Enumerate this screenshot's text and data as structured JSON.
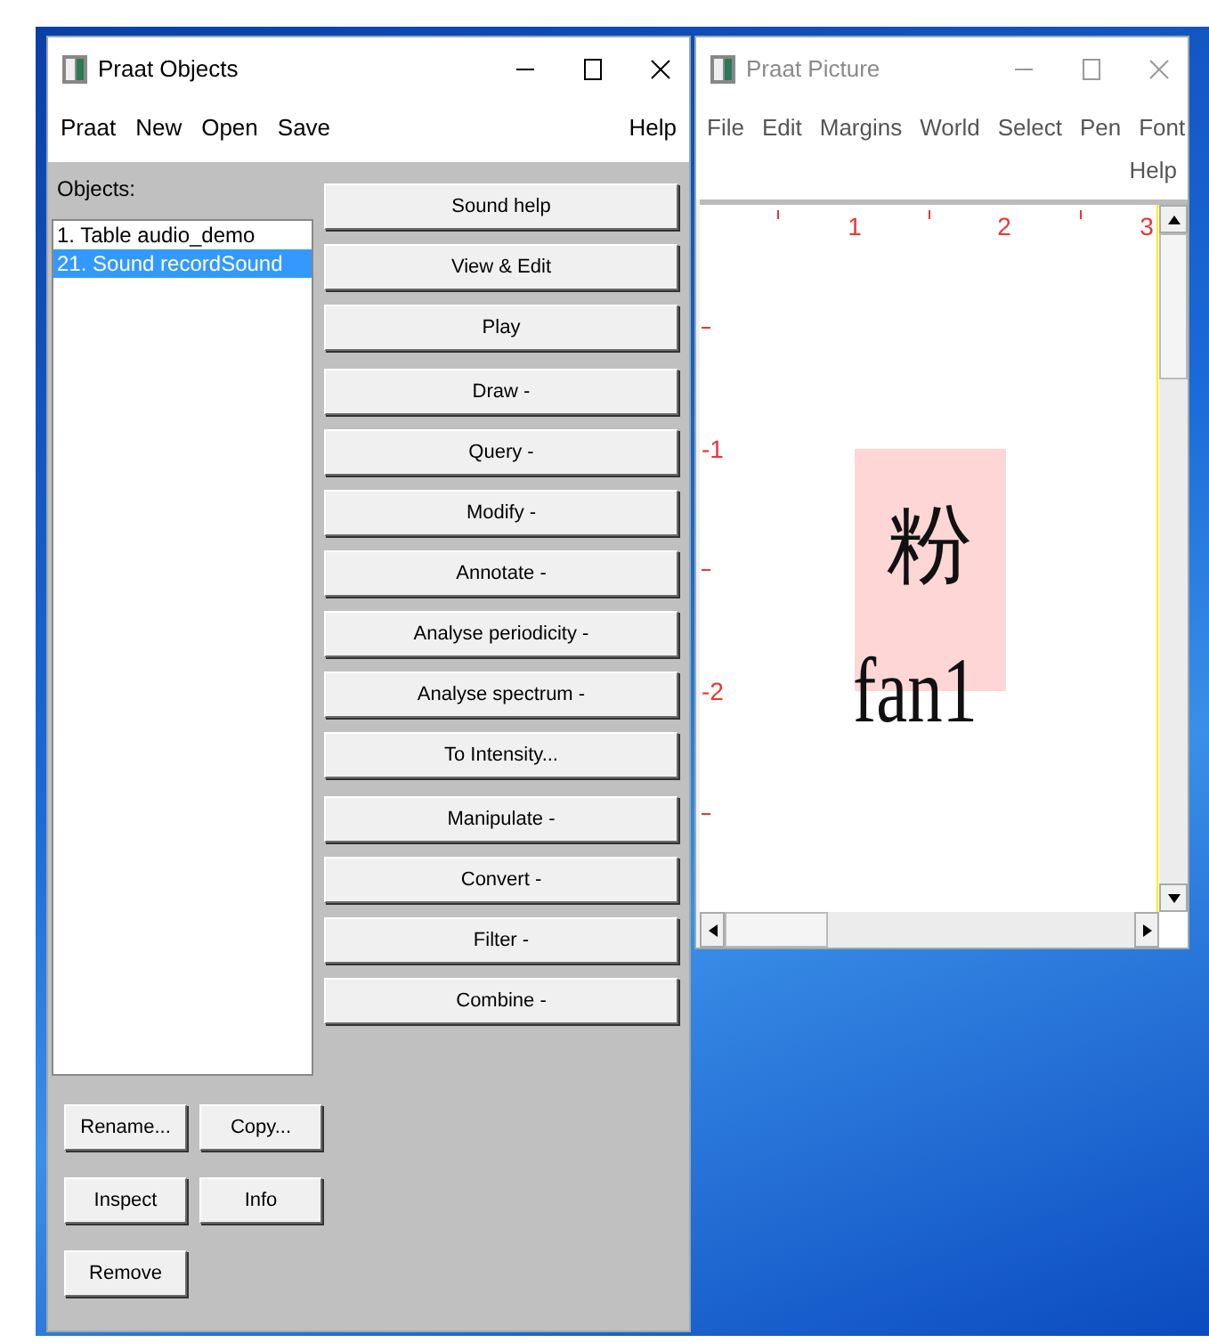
{
  "objects_window": {
    "title": "Praat Objects",
    "menu": [
      "Praat",
      "New",
      "Open",
      "Save"
    ],
    "help_menu": "Help",
    "objects_label": "Objects:",
    "objects": [
      {
        "label": "1. Table audio_demo",
        "selected": false
      },
      {
        "label": "21. Sound recordSound",
        "selected": true
      }
    ],
    "action_groups": [
      [
        "Sound help",
        "View & Edit",
        "Play"
      ],
      [
        "Draw -",
        "Query -",
        "Modify -",
        "Annotate -",
        "Analyse periodicity -",
        "Analyse spectrum -",
        "To Intensity..."
      ],
      [
        "Manipulate -",
        "Convert -",
        "Filter -",
        "Combine -"
      ]
    ],
    "bottom_buttons": [
      [
        "Rename...",
        "Copy..."
      ],
      [
        "Inspect",
        "Info"
      ],
      [
        "Remove"
      ]
    ]
  },
  "picture_window": {
    "title": "Praat Picture",
    "active": false,
    "menu": [
      "File",
      "Edit",
      "Margins",
      "World",
      "Select",
      "Pen",
      "Font"
    ],
    "help_menu": "Help",
    "x_labels": [
      "1",
      "2",
      "3"
    ],
    "y_labels": [
      "-1",
      "-2"
    ],
    "character": "粉",
    "pinyin": "fan1"
  }
}
